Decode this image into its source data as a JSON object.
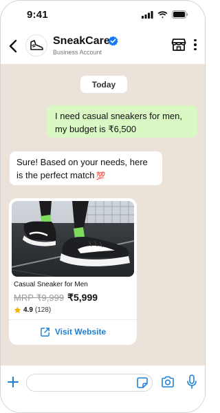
{
  "status_bar": {
    "time": "9:41"
  },
  "header": {
    "business_name": "SneakCare",
    "business_subtitle": "Business Account"
  },
  "chat": {
    "date_chip": "Today",
    "outgoing_message": {
      "line1": "I need casual sneakers for men,",
      "line2": "my budget is ₹6,500"
    },
    "incoming_message": {
      "line1": "Sure! Based on your needs, here",
      "line2": "is the perfect match",
      "emoji": "💯"
    },
    "product_card": {
      "title": "Casual Sneaker for Men",
      "mrp": "MRP ₹9,999",
      "price": "₹5,999",
      "rating": "4.9",
      "review_count": "(128)",
      "cta_label": "Visit Website"
    }
  },
  "input_bar": {
    "placeholder": ""
  },
  "colors": {
    "chat_background": "#ebe3da",
    "outgoing_bubble": "#d9f8c4",
    "accent_blue": "#1d7fd6",
    "verified_badge": "#1877f2",
    "star": "#f5b400"
  },
  "icons": [
    "signal-icon",
    "wifi-icon",
    "battery-icon",
    "back-arrow-icon",
    "sneaker-logo-icon",
    "verified-badge-icon",
    "store-icon",
    "more-vertical-icon",
    "star-icon",
    "external-link-icon",
    "plus-icon",
    "sticker-icon",
    "camera-icon",
    "mic-icon"
  ]
}
